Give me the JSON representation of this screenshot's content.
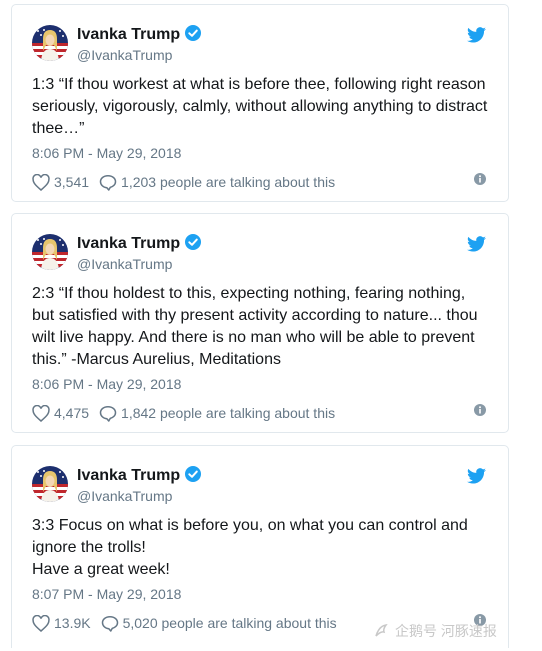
{
  "account": {
    "name": "Ivanka Trump",
    "handle": "@IvankaTrump"
  },
  "colors": {
    "brand": "#1da1f2",
    "text": "#14171a",
    "muted": "#657786",
    "border": "#e1e8ed"
  },
  "icons": {
    "like": "heart-icon",
    "reply": "speech-bubble-icon",
    "info": "info-icon",
    "logo": "twitter-bird-icon",
    "verified": "verified-badge-icon"
  },
  "tweets": [
    {
      "text": "1:3 “If thou workest at what is before thee, following right reason seriously, vigorously, calmly, without allowing anything to distract thee…”",
      "time": "8:06 PM - May 29, 2018",
      "likes": "3,541",
      "talking": "1,203 people are talking about this"
    },
    {
      "text": "2:3 “If thou holdest to this, expecting nothing, fearing nothing, but satisfied with thy present activity according to nature... thou wilt live happy. And there is no man who will be able to prevent this.” -Marcus Aurelius, Meditations",
      "time": "8:06 PM - May 29, 2018",
      "likes": "4,475",
      "talking": "1,842 people are talking about this"
    },
    {
      "text": "3:3 Focus on what is before you, on what you can control and ignore the trolls!\nHave a great week!",
      "time": "8:07 PM - May 29, 2018",
      "likes": "13.9K",
      "talking": "5,020 people are talking about this"
    }
  ],
  "watermark": "企鹅号 河豚速报"
}
